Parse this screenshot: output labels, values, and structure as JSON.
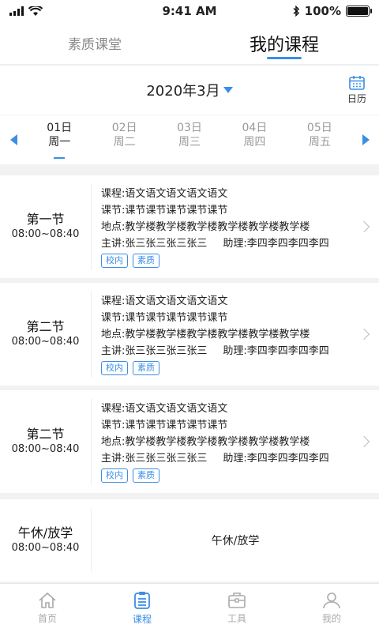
{
  "status": {
    "time": "9:41 AM",
    "battery": "100%"
  },
  "top_tabs": [
    {
      "label": "素质课堂",
      "active": false
    },
    {
      "label": "我的课程",
      "active": true
    }
  ],
  "month": {
    "label": "2020年3月",
    "calendar_label": "日历"
  },
  "days": [
    {
      "date": "01日",
      "weekday": "周一",
      "active": true
    },
    {
      "date": "02日",
      "weekday": "周二",
      "active": false
    },
    {
      "date": "03日",
      "weekday": "周三",
      "active": false
    },
    {
      "date": "04日",
      "weekday": "周四",
      "active": false
    },
    {
      "date": "05日",
      "weekday": "周五",
      "active": false
    }
  ],
  "courses": [
    {
      "period": "第一节",
      "time": "08:00~08:40",
      "course": "课程:语文语文语文语文语文",
      "section": "课节:课节课节课节课节课节",
      "place": "地点:教学楼教学楼教学楼教学楼教学楼教学楼",
      "teacher": "主讲:张三张三张三张三",
      "assistant": "助理:李四李四李四李四",
      "tags": [
        "校内",
        "素质"
      ]
    },
    {
      "period": "第二节",
      "time": "08:00~08:40",
      "course": "课程:语文语文语文语文语文",
      "section": "课节:课节课节课节课节课节",
      "place": "地点:教学楼教学楼教学楼教学楼教学楼教学楼",
      "teacher": "主讲:张三张三张三张三",
      "assistant": "助理:李四李四李四李四",
      "tags": [
        "校内",
        "素质"
      ]
    },
    {
      "period": "第二节",
      "time": "08:00~08:40",
      "course": "课程:语文语文语文语文语文",
      "section": "课节:课节课节课节课节课节",
      "place": "地点:教学楼教学楼教学楼教学楼教学楼教学楼",
      "teacher": "主讲:张三张三张三张三",
      "assistant": "助理:李四李四李四李四",
      "tags": [
        "校内",
        "素质"
      ]
    }
  ],
  "lunch": {
    "period": "午休/放学",
    "time": "08:00~08:40",
    "text": "午休/放学"
  },
  "tabbar": [
    {
      "label": "首页",
      "icon": "home-icon",
      "active": false
    },
    {
      "label": "课程",
      "icon": "course-icon",
      "active": true
    },
    {
      "label": "工具",
      "icon": "toolbox-icon",
      "active": false
    },
    {
      "label": "我的",
      "icon": "user-icon",
      "active": false
    }
  ],
  "colors": {
    "accent": "#3a8ee6"
  }
}
